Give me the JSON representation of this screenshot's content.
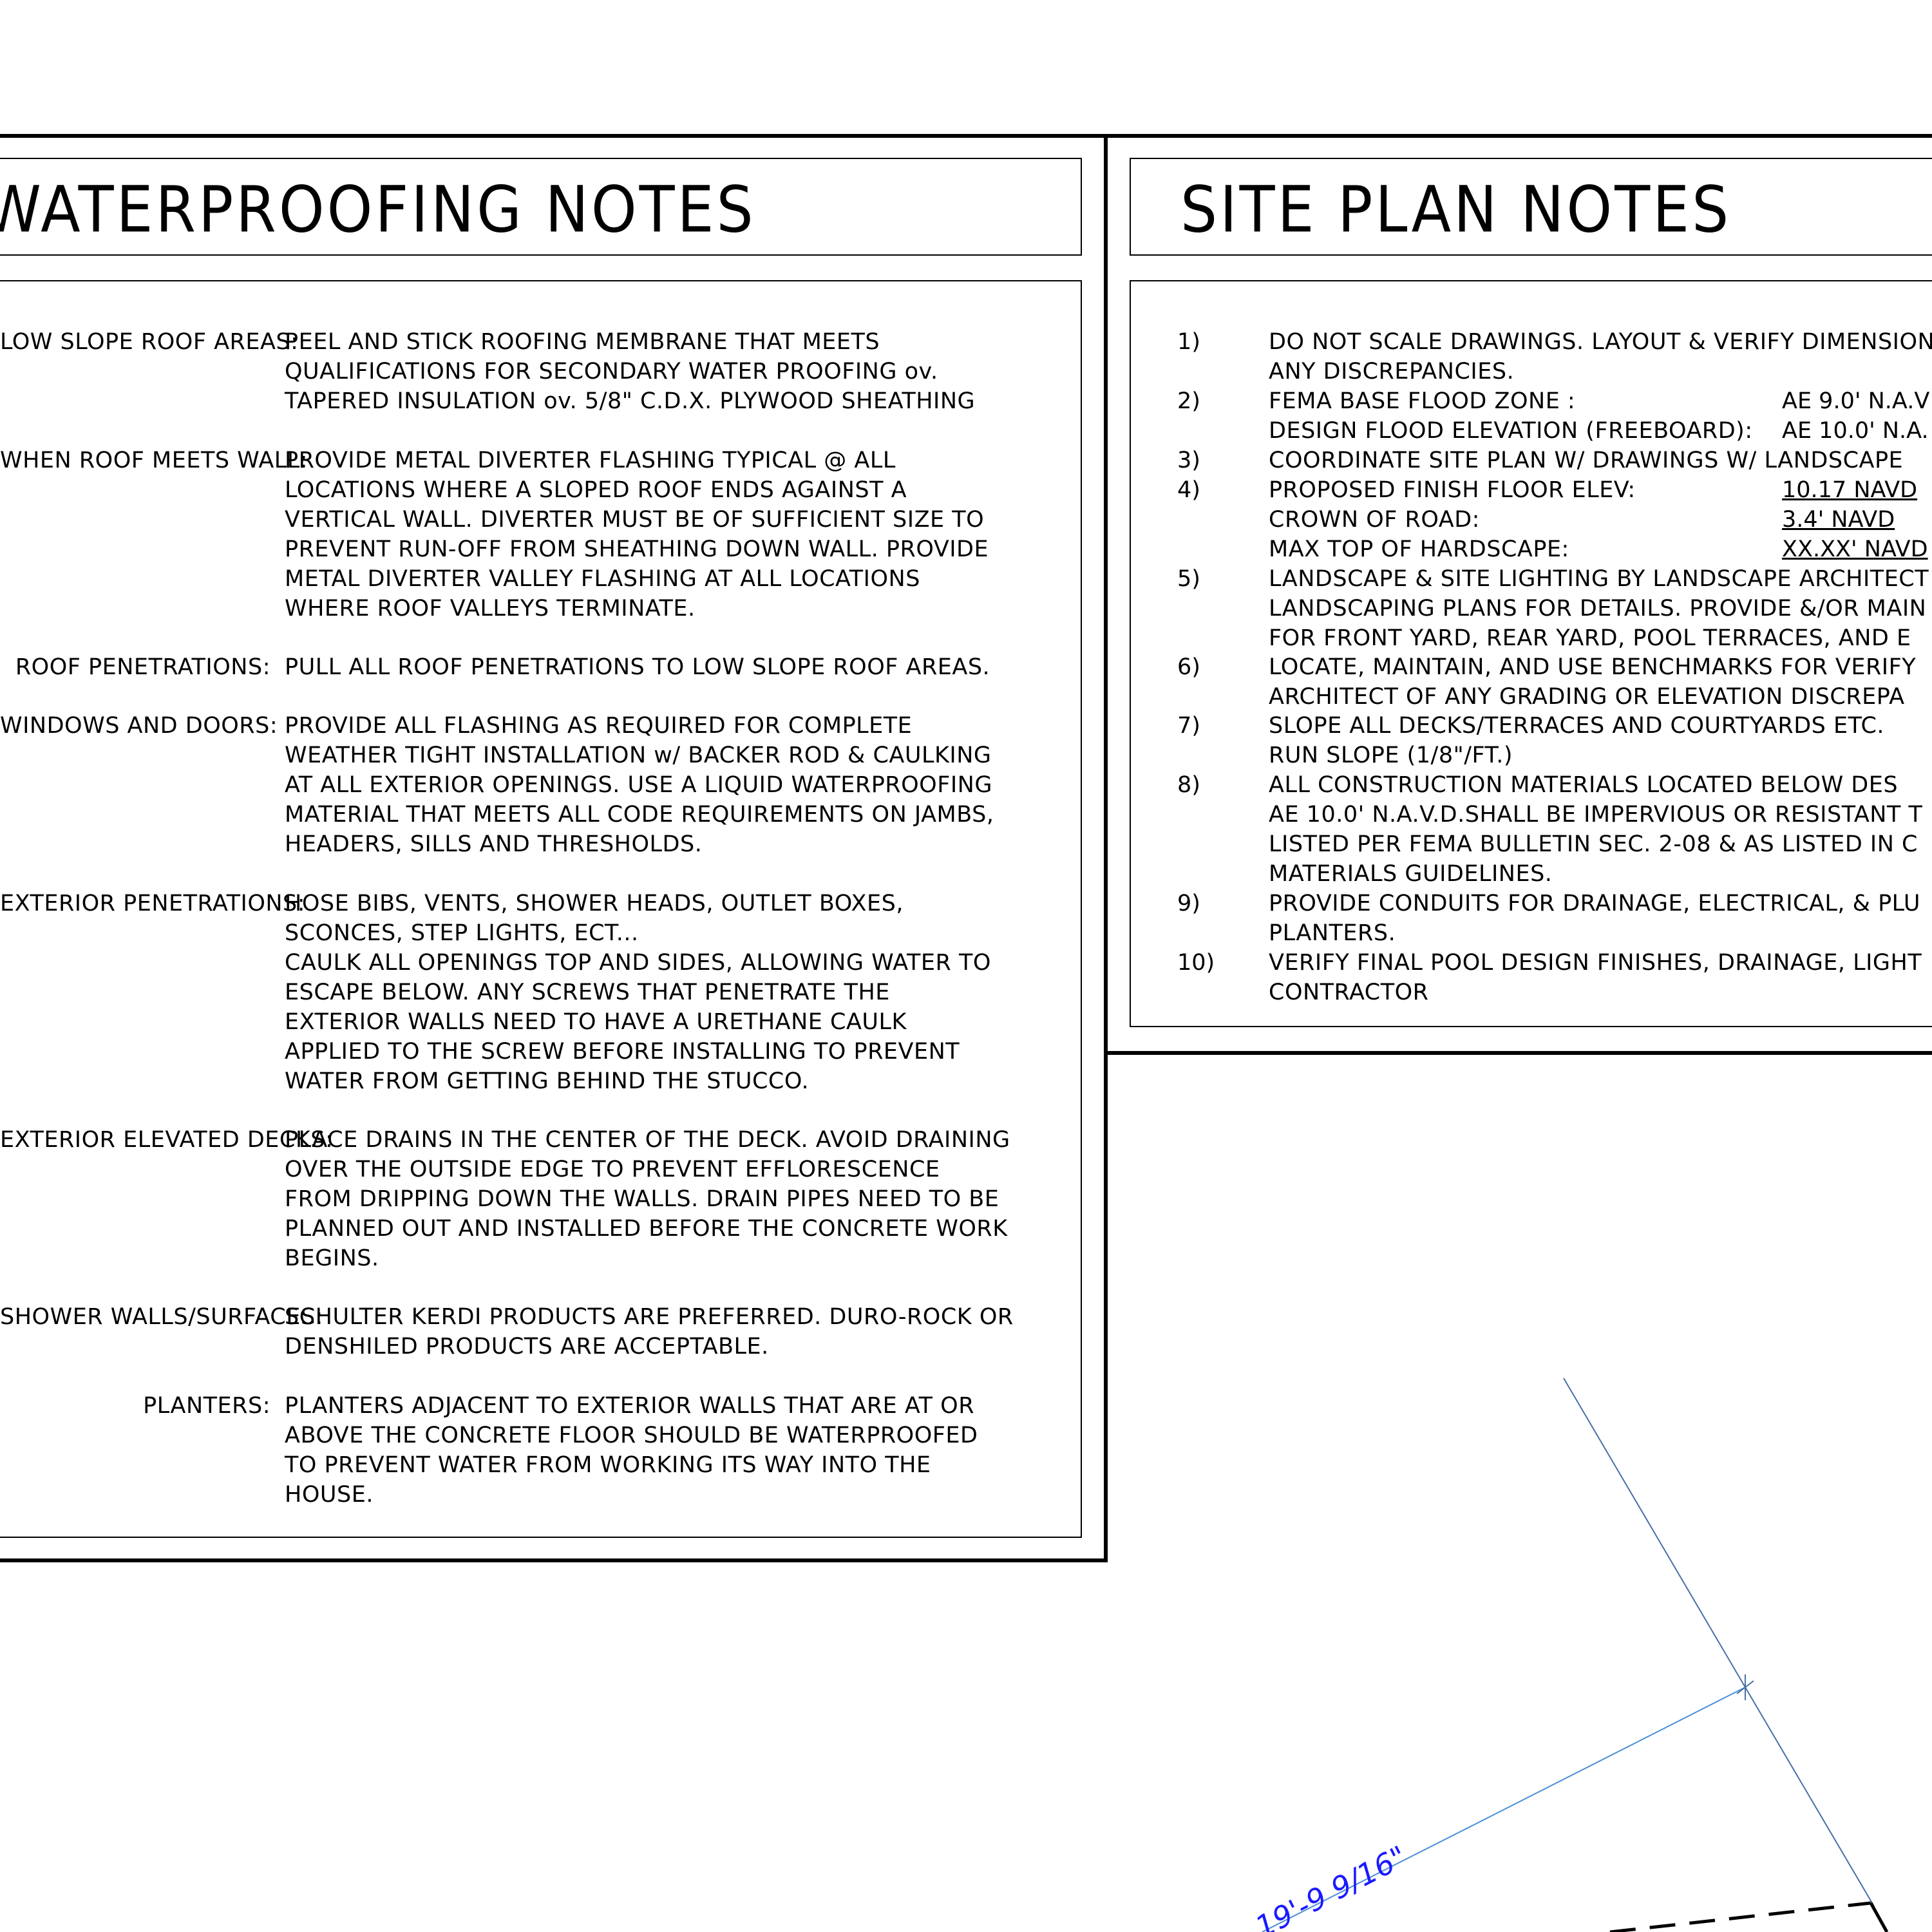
{
  "waterproofing": {
    "title": "WATERPROOFING NOTES",
    "notes": [
      {
        "label": "LOW SLOPE ROOF AREAS:",
        "text": "PEEL AND STICK ROOFING MEMBRANE THAT MEETS\nQUALIFICATIONS FOR SECONDARY WATER PROOFING ov.\nTAPERED INSULATION ov. 5/8\" C.D.X. PLYWOOD SHEATHING"
      },
      {
        "label": "WHEN ROOF MEETS WALL:",
        "text": "PROVIDE METAL DIVERTER FLASHING TYPICAL @ ALL\nLOCATIONS WHERE A SLOPED ROOF ENDS AGAINST A\nVERTICAL WALL. DIVERTER MUST BE OF SUFFICIENT SIZE TO\nPREVENT RUN-OFF FROM SHEATHING DOWN WALL. PROVIDE\nMETAL DIVERTER VALLEY FLASHING AT ALL LOCATIONS\nWHERE ROOF VALLEYS TERMINATE."
      },
      {
        "label": "ROOF PENETRATIONS:",
        "text": "PULL ALL ROOF PENETRATIONS TO LOW SLOPE ROOF AREAS."
      },
      {
        "label": "WINDOWS AND DOORS:",
        "text": "PROVIDE ALL FLASHING AS REQUIRED FOR COMPLETE\nWEATHER TIGHT INSTALLATION w/ BACKER ROD & CAULKING\nAT ALL EXTERIOR OPENINGS. USE A LIQUID WATERPROOFING\nMATERIAL THAT MEETS ALL CODE REQUIREMENTS ON JAMBS,\nHEADERS, SILLS AND THRESHOLDS."
      },
      {
        "label": "EXTERIOR PENETRATIONS:",
        "text": "HOSE BIBS, VENTS, SHOWER HEADS, OUTLET BOXES,\nSCONCES, STEP LIGHTS, ECT...\nCAULK ALL OPENINGS TOP AND SIDES, ALLOWING WATER TO\nESCAPE BELOW. ANY SCREWS THAT PENETRATE THE\nEXTERIOR WALLS NEED TO HAVE A URETHANE CAULK\nAPPLIED TO THE SCREW BEFORE INSTALLING TO PREVENT\nWATER FROM GETTING BEHIND THE STUCCO."
      },
      {
        "label": "EXTERIOR ELEVATED DECKS:",
        "text": "PLACE DRAINS IN THE CENTER OF THE DECK. AVOID DRAINING\nOVER THE OUTSIDE EDGE TO PREVENT EFFLORESCENCE\nFROM DRIPPING DOWN THE WALLS. DRAIN PIPES NEED TO BE\nPLANNED OUT AND INSTALLED BEFORE THE CONCRETE WORK\nBEGINS."
      },
      {
        "label": "SHOWER WALLS/SURFACES:",
        "text": "SCHULTER KERDI PRODUCTS ARE PREFERRED. DURO-ROCK OR\nDENSHILED PRODUCTS ARE ACCEPTABLE."
      },
      {
        "label": "PLANTERS:",
        "text": "PLANTERS ADJACENT TO EXTERIOR WALLS THAT ARE AT OR\nABOVE THE CONCRETE FLOOR SHOULD BE WATERPROOFED\nTO PREVENT WATER FROM WORKING ITS WAY INTO THE\nHOUSE."
      }
    ]
  },
  "site_plan": {
    "title": "SITE PLAN NOTES",
    "notes": [
      {
        "num": "1)",
        "text": "DO NOT SCALE DRAWINGS. LAYOUT & VERIFY DIMENSIONS\nANY DISCREPANCIES."
      },
      {
        "num": "2)",
        "text": "FEMA BASE FLOOD ZONE :\nDESIGN FLOOD ELEVATION (FREEBOARD):"
      },
      {
        "num": "3)",
        "text": "COORDINATE SITE PLAN W/ DRAWINGS W/ LANDSCAPE"
      },
      {
        "num": "4)",
        "text": "PROPOSED FINISH FLOOR ELEV:\nCROWN OF ROAD:\nMAX TOP OF HARDSCAPE:"
      },
      {
        "num": "5)",
        "text": "LANDSCAPE & SITE LIGHTING BY LANDSCAPE ARCHITECT\nLANDSCAPING PLANS FOR DETAILS. PROVIDE &/OR MAIN\nFOR FRONT YARD, REAR YARD, POOL TERRACES, AND E"
      },
      {
        "num": "6)",
        "text": "LOCATE, MAINTAIN, AND USE BENCHMARKS FOR VERIFY\nARCHITECT OF ANY GRADING OR ELEVATION DISCREPA"
      },
      {
        "num": "7)",
        "text": "SLOPE ALL DECKS/TERRACES AND COURTYARDS ETC.\nRUN SLOPE (1/8\"/FT.)"
      },
      {
        "num": "8)",
        "text": "ALL CONSTRUCTION MATERIALS LOCATED BELOW DES\nAE 10.0' N.A.V.D.SHALL BE IMPERVIOUS OR RESISTANT T\nLISTED PER FEMA BULLETIN SEC. 2-08 & AS LISTED IN C\nMATERIALS GUIDELINES."
      },
      {
        "num": "9)",
        "text": "PROVIDE CONDUITS FOR DRAINAGE, ELECTRICAL, & PLU\nPLANTERS."
      },
      {
        "num": "10)",
        "text": "VERIFY FINAL POOL DESIGN FINISHES, DRAINAGE, LIGHT\nCONTRACTOR"
      }
    ],
    "values": {
      "base_flood": "AE 9.0' N.A.V",
      "design_flood": "AE 10.0' N.A.",
      "finish_floor": "10.17 NAVD",
      "crown_of_road": "3.4' NAVD",
      "max_hardscape": "XX.XX' NAVD"
    }
  },
  "drawing": {
    "dimension_label": "19'-9 9/16\"",
    "dimension_color": "#1a1aff"
  }
}
